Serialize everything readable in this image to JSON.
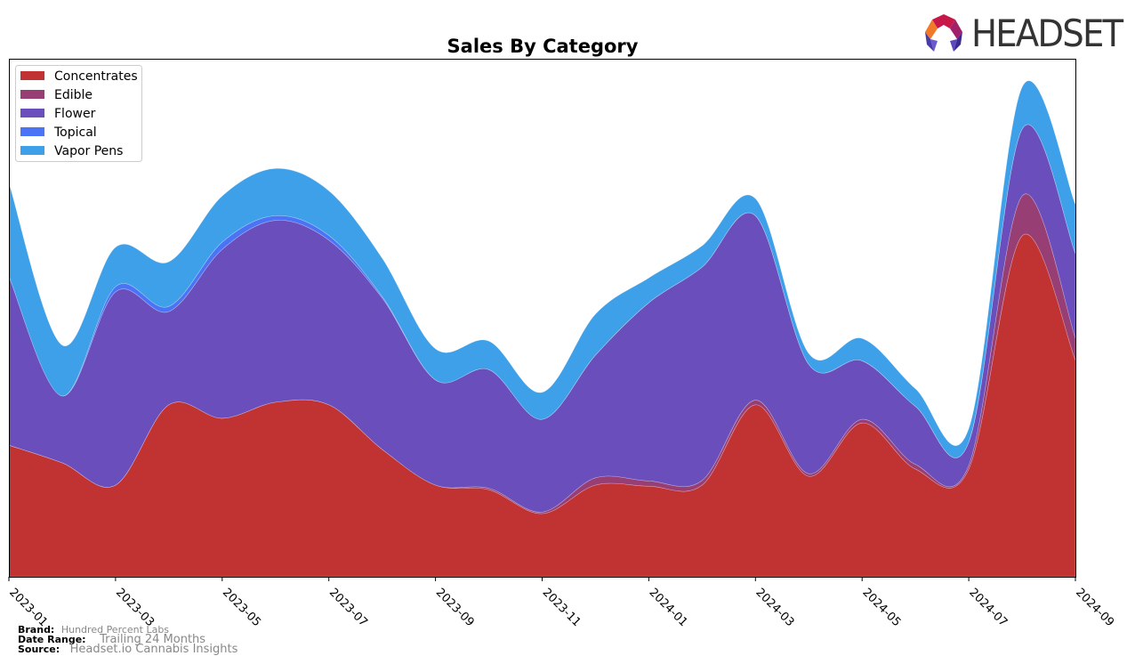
{
  "brand_logo": {
    "text": "HEADSET",
    "icon": "headset-logo-icon"
  },
  "footer": {
    "brand_label": "Brand:",
    "brand_value": "Hundred Percent Labs",
    "date_range_label": "Date Range:",
    "date_range_value": "Trailing 24 Months",
    "source_label": "Source:",
    "source_value": "Headset.io Cannabis Insights"
  },
  "chart_data": {
    "type": "area",
    "stacked": true,
    "title": "Sales By Category",
    "xlabel": "",
    "ylabel": "",
    "x": [
      "2023-01",
      "2023-02",
      "2023-03",
      "2023-04",
      "2023-05",
      "2023-06",
      "2023-07",
      "2023-08",
      "2023-09",
      "2023-10",
      "2023-11",
      "2023-12",
      "2024-01",
      "2024-02",
      "2024-03",
      "2024-04",
      "2024-05",
      "2024-06",
      "2024-07",
      "2024-08",
      "2024-09"
    ],
    "x_tick_labels": [
      "2023-01",
      "2023-03",
      "2023-05",
      "2023-07",
      "2023-09",
      "2023-11",
      "2024-01",
      "2024-03",
      "2024-05",
      "2024-07",
      "2024-09"
    ],
    "y_ticks_visible": false,
    "ylim": [
      0,
      100
    ],
    "grid": false,
    "legend_position": "top-left",
    "series": [
      {
        "name": "Concentrates",
        "color": "#c13333",
        "values": [
          25.4,
          22.0,
          17.7,
          33.2,
          30.6,
          33.7,
          33.2,
          24.6,
          17.7,
          16.8,
          12.2,
          17.7,
          17.5,
          17.7,
          33.2,
          19.4,
          29.7,
          20.8,
          20.8,
          65.8,
          41.8
        ]
      },
      {
        "name": "Edible",
        "color": "#973f74",
        "values": [
          0.0,
          0.0,
          0.0,
          0.0,
          0.0,
          0.0,
          0.0,
          0.0,
          0.0,
          0.3,
          0.3,
          1.4,
          1.0,
          0.9,
          0.9,
          0.5,
          0.7,
          0.9,
          0.7,
          7.7,
          4.3
        ]
      },
      {
        "name": "Flower",
        "color": "#6a4fbc",
        "values": [
          32.6,
          12.9,
          37.3,
          18.0,
          32.6,
          35.1,
          31.8,
          29.2,
          20.3,
          22.9,
          17.9,
          23.7,
          34.4,
          41.2,
          35.6,
          21.1,
          11.3,
          11.2,
          4.5,
          12.9,
          16.3
        ]
      },
      {
        "name": "Topical",
        "color": "#4a74f5",
        "values": [
          0.0,
          0.0,
          1.0,
          1.0,
          1.4,
          0.9,
          0.9,
          0.3,
          0.0,
          0.0,
          0.0,
          0.0,
          0.0,
          0.0,
          0.0,
          0.0,
          0.0,
          0.0,
          0.0,
          0.0,
          0.0
        ]
      },
      {
        "name": "Vapor Pens",
        "color": "#3ea0e8",
        "values": [
          18.0,
          9.8,
          7.6,
          8.6,
          8.9,
          9.1,
          8.6,
          7.4,
          6.0,
          5.5,
          5.2,
          7.9,
          4.8,
          4.1,
          3.3,
          2.1,
          4.3,
          3.4,
          2.6,
          8.1,
          9.5
        ]
      }
    ]
  }
}
